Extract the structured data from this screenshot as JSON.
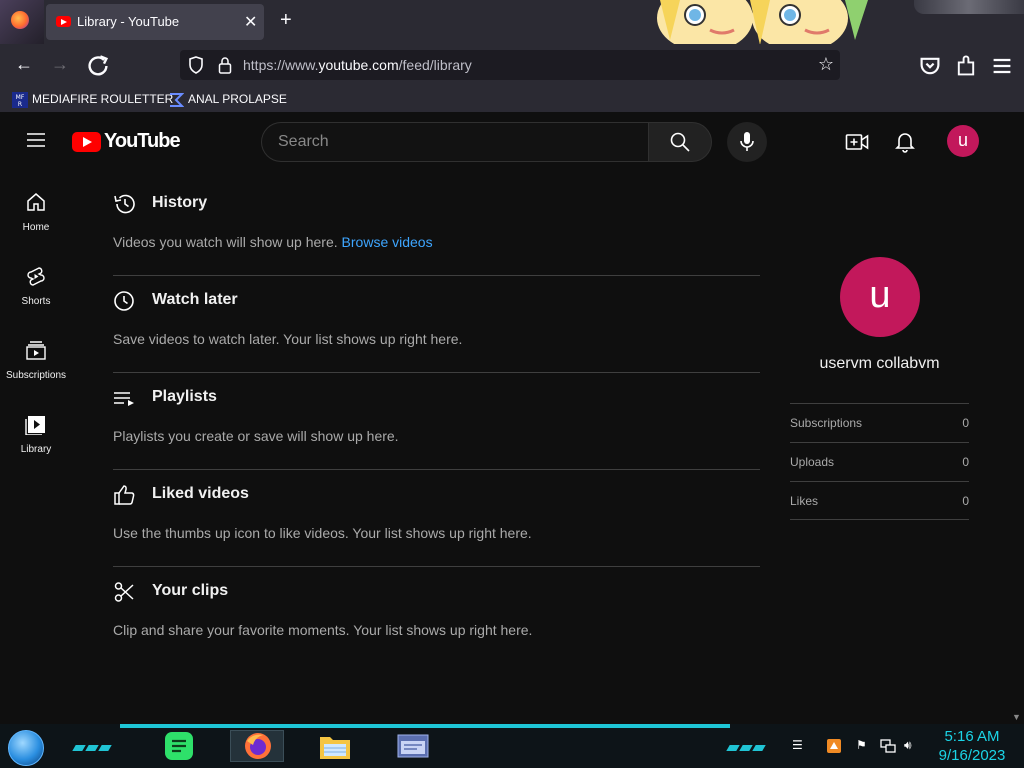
{
  "browser": {
    "tab_title": "Library - YouTube",
    "tab_close": "✕",
    "new_tab": "+",
    "url_prefix": "https://www.",
    "url_host": "youtube.com",
    "url_path": "/feed/library",
    "bookmarks": [
      {
        "label": "MEDIAFIRE ROULETTER",
        "icon": "mediafire-icon"
      },
      {
        "label": "ANAL PROLAPSE",
        "icon": "bookmark-sigma-icon"
      }
    ]
  },
  "youtube": {
    "logo_text": "YouTube",
    "search_placeholder": "Search",
    "avatar_letter": "u",
    "guide": [
      {
        "label": "Home",
        "icon": "home-icon"
      },
      {
        "label": "Shorts",
        "icon": "shorts-icon"
      },
      {
        "label": "Subscriptions",
        "icon": "subscriptions-icon"
      },
      {
        "label": "Library",
        "icon": "library-icon"
      }
    ],
    "sections": [
      {
        "title": "History",
        "desc": "Videos you watch will show up here.",
        "link": "Browse videos",
        "icon": "history-icon"
      },
      {
        "title": "Watch later",
        "desc": "Save videos to watch later. Your list shows up right here.",
        "icon": "watch-later-icon"
      },
      {
        "title": "Playlists",
        "desc": "Playlists you create or save will show up here.",
        "icon": "playlists-icon"
      },
      {
        "title": "Liked videos",
        "desc": "Use the thumbs up icon to like videos. Your list shows up right here.",
        "icon": "thumbs-up-icon"
      },
      {
        "title": "Your clips",
        "desc": "Clip and share your favorite moments. Your list shows up right here.",
        "icon": "scissors-icon"
      }
    ],
    "profile": {
      "avatar_letter": "u",
      "name": "uservm collabvm",
      "stats": [
        {
          "label": "Subscriptions",
          "value": "0"
        },
        {
          "label": "Uploads",
          "value": "0"
        },
        {
          "label": "Likes",
          "value": "0"
        }
      ]
    }
  },
  "taskbar": {
    "time": "5:16 AM",
    "date": "9/16/2023",
    "apps": [
      "notes-app-icon",
      "firefox-icon",
      "file-explorer-icon",
      "window-app-icon"
    ]
  },
  "colors": {
    "yt_bg": "#0f0f0f",
    "yt_red": "#ff0000",
    "link_blue": "#3ea6ff",
    "avatar_pink": "#c2185b",
    "taskbar_accent": "#1ec6d6"
  }
}
